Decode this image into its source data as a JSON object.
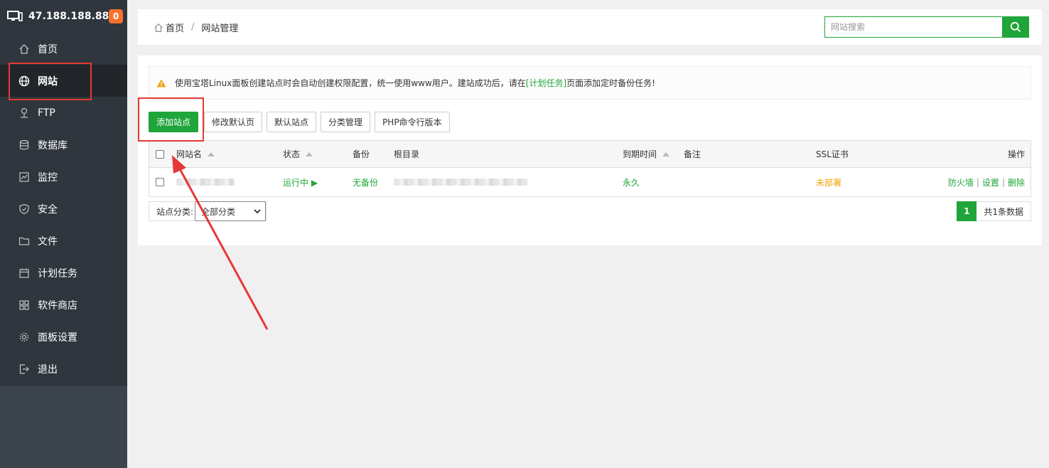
{
  "sidebar": {
    "server_ip": "47.188.188.88",
    "badge_count": "0",
    "items": [
      {
        "label": "首页",
        "icon": "home-icon"
      },
      {
        "label": "网站",
        "icon": "globe-icon",
        "active": true
      },
      {
        "label": "FTP",
        "icon": "ftp-icon"
      },
      {
        "label": "数据库",
        "icon": "database-icon"
      },
      {
        "label": "监控",
        "icon": "monitor-icon"
      },
      {
        "label": "安全",
        "icon": "shield-icon"
      },
      {
        "label": "文件",
        "icon": "folder-icon"
      },
      {
        "label": "计划任务",
        "icon": "calendar-icon"
      },
      {
        "label": "软件商店",
        "icon": "apps-icon"
      },
      {
        "label": "面板设置",
        "icon": "gear-icon"
      },
      {
        "label": "退出",
        "icon": "logout-icon"
      }
    ]
  },
  "breadcrumb": {
    "home": "首页",
    "separator": "/",
    "current": "网站管理"
  },
  "search": {
    "placeholder": "网站搜索"
  },
  "notice": {
    "text_before": "使用宝塔Linux面板创建站点时会自动创建权限配置，统一使用www用户。建站成功后，请在",
    "link": "[计划任务]",
    "text_after": "页面添加定时备份任务!"
  },
  "toolbar": {
    "add_site": "添加站点",
    "modify_default_page": "修改默认页",
    "default_site": "默认站点",
    "category_manage": "分类管理",
    "php_cli_version": "PHP命令行版本"
  },
  "table": {
    "headers": {
      "site_name": "网站名",
      "status": "状态",
      "backup": "备份",
      "root_dir": "根目录",
      "expire": "到期时间",
      "remark": "备注",
      "ssl": "SSL证书",
      "actions": "操作"
    },
    "rows": [
      {
        "status": "运行中 ▶",
        "backup": "无备份",
        "expire": "永久",
        "remark": "",
        "ssl": "未部署",
        "action_firewall": "防火墙",
        "action_settings": "设置",
        "action_delete": "删除"
      }
    ]
  },
  "footer": {
    "category_label": "站点分类:",
    "category_selected": "全部分类",
    "current_page": "1",
    "total_text": "共1条数据"
  },
  "colors": {
    "accent": "#20a53a",
    "sidebar_bg": "#2f363d",
    "annotation": "#e53935",
    "warning": "#f0a30a"
  }
}
